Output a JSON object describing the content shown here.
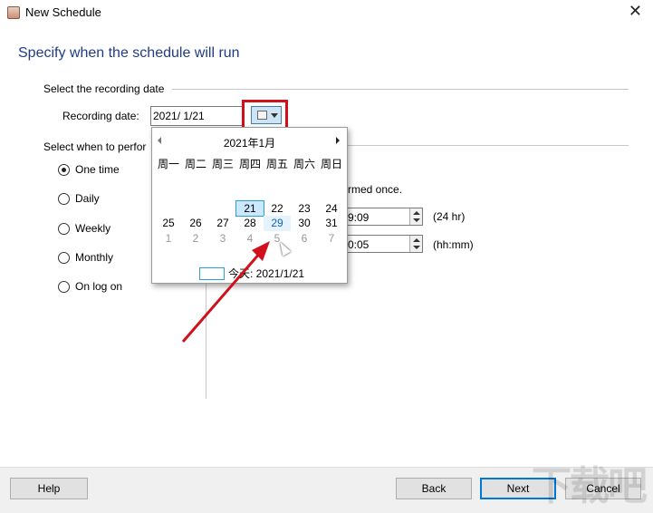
{
  "window": {
    "title": "New Schedule"
  },
  "heading": "Specify when the schedule will run",
  "date_section": {
    "group_label": "Select the recording date",
    "field_label": "Recording date:",
    "field_value": "2021/  1/21"
  },
  "when_section": {
    "group_label": "Select when to perfor",
    "options": [
      {
        "label": "One time",
        "selected": true
      },
      {
        "label": "Daily",
        "selected": false
      },
      {
        "label": "Weekly",
        "selected": false
      },
      {
        "label": "Monthly",
        "selected": false
      },
      {
        "label": "On log on",
        "selected": false
      }
    ],
    "partial_text": "rmed once.",
    "time_fields": [
      {
        "value": "9:09",
        "unit": "(24 hr)"
      },
      {
        "value": "0:05",
        "unit": "(hh:mm)"
      }
    ]
  },
  "calendar": {
    "month_label": "2021年1月",
    "weekdays": [
      "周一",
      "周二",
      "周三",
      "周四",
      "周五",
      "周六",
      "周日"
    ],
    "rows": [
      [
        "",
        "",
        "",
        "",
        "",
        "",
        ""
      ],
      [
        "",
        "",
        "",
        "21",
        "22",
        "23",
        "24"
      ],
      [
        "25",
        "26",
        "27",
        "28",
        "29",
        "30",
        "31"
      ],
      [
        "1",
        "2",
        "3",
        "4",
        "5",
        "6",
        "7"
      ]
    ],
    "today_label": "今天: 2021/1/21"
  },
  "footer": {
    "help": "Help",
    "back": "Back",
    "next": "Next",
    "cancel": "Cancel"
  },
  "colors": {
    "heading": "#1f3c88",
    "highlight": "#d0101a",
    "accent": "#0078d7"
  },
  "watermark": "下载吧"
}
